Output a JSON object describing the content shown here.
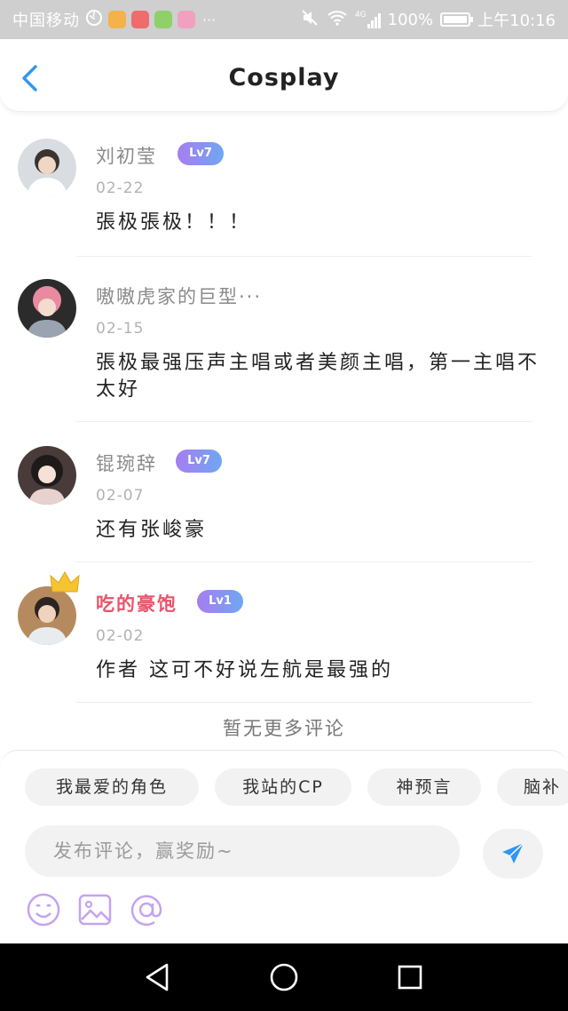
{
  "status_bar": {
    "carrier": "中国移动",
    "more": "···",
    "signal_label": "4G",
    "battery": "100%",
    "battery_level": 1.0,
    "time": "上午10:16"
  },
  "header": {
    "title": "Cosplay",
    "back_icon": "chevron-left-icon"
  },
  "comments": [
    {
      "username": "刘初莹",
      "level": "Lv7",
      "date": "02-22",
      "text": "張极張极！！！",
      "vip": false
    },
    {
      "username": "嗷嗷虎家的巨型···",
      "level": "",
      "date": "02-15",
      "text": "張极最强压声主唱或者美颜主唱，第一主唱不太好",
      "vip": false
    },
    {
      "username": "锟琬辞",
      "level": "Lv7",
      "date": "02-07",
      "text": "还有张峻豪",
      "vip": false
    },
    {
      "username": "吃的豪饱",
      "level": "Lv1",
      "date": "02-02",
      "text": "作者 这可不好说左航是最强的",
      "vip": true
    }
  ],
  "footer_note": "暂无更多评论",
  "tags": [
    "我最爱的角色",
    "我站的CP",
    "神预言",
    "脑补"
  ],
  "input": {
    "placeholder": "发布评论，赢奖励~",
    "value": ""
  },
  "toolbar_icons": [
    "emoji-icon",
    "image-icon",
    "at-icon"
  ],
  "colors": {
    "accent": "#2f97f0",
    "badge_start": "#a77df0",
    "badge_end": "#6fa7f2",
    "vip_name": "#e8546a",
    "tool_icon": "#c5a3ef"
  }
}
